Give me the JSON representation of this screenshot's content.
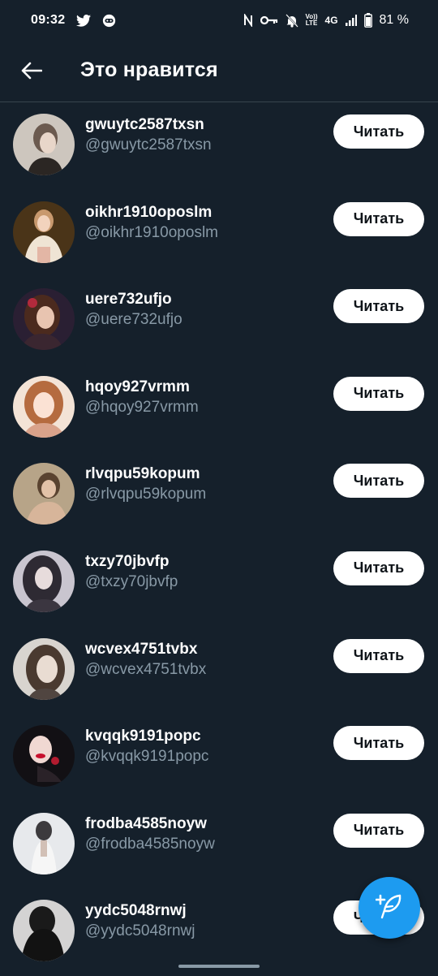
{
  "status_bar": {
    "time": "09:32",
    "network": "4G",
    "volte_top": "Vo))",
    "volte_bottom": "LTE",
    "battery": "81 %"
  },
  "header": {
    "title": "Это нравится",
    "back_icon": "arrow-left-icon"
  },
  "users": [
    {
      "name": "gwuytc2587txsn",
      "handle": "@gwuytc2587txsn",
      "button": "Читать"
    },
    {
      "name": "oikhr1910oposlm",
      "handle": "@oikhr1910oposlm",
      "button": "Читать"
    },
    {
      "name": "uere732ufjo",
      "handle": "@uere732ufjo",
      "button": "Читать"
    },
    {
      "name": "hqoy927vrmm",
      "handle": "@hqoy927vrmm",
      "button": "Читать"
    },
    {
      "name": "rlvqpu59kopum",
      "handle": "@rlvqpu59kopum",
      "button": "Читать"
    },
    {
      "name": "txzy70jbvfp",
      "handle": "@txzy70jbvfp",
      "button": "Читать"
    },
    {
      "name": "wcvex4751tvbx",
      "handle": "@wcvex4751tvbx",
      "button": "Читать"
    },
    {
      "name": "kvqqk9191popc",
      "handle": "@kvqqk9191popc",
      "button": "Читать"
    },
    {
      "name": "frodba4585noyw",
      "handle": "@frodba4585noyw",
      "button": "Читать"
    },
    {
      "name": "yydc5048rnwj",
      "handle": "@yydc5048rnwj",
      "button": "Читать"
    }
  ],
  "fab": {
    "icon": "compose-feather-icon"
  },
  "colors": {
    "background": "#15202b",
    "secondary_text": "#8899a6",
    "accent": "#1d9bf0",
    "button_bg": "#ffffff"
  }
}
